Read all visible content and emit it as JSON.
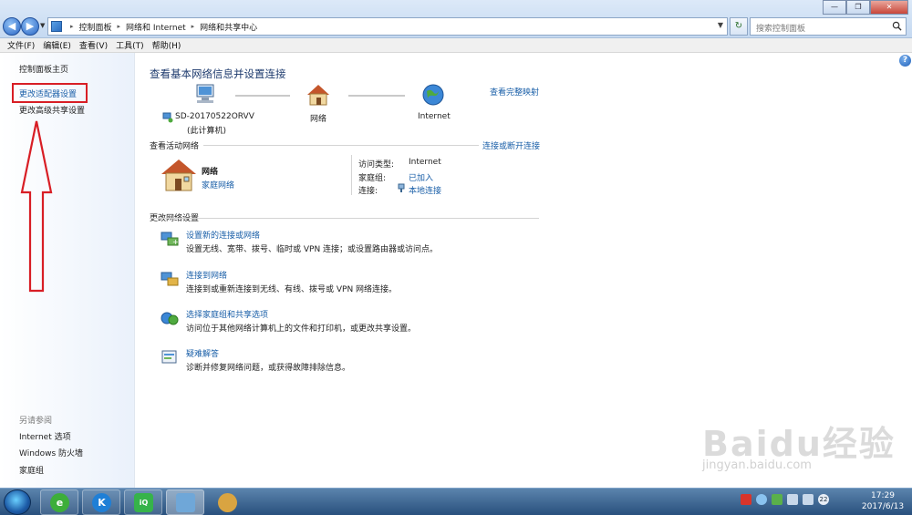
{
  "window": {
    "breadcrumbs": [
      "控制面板",
      "网络和 Internet",
      "网络和共享中心"
    ],
    "search_placeholder": "搜索控制面板"
  },
  "menubar": [
    "文件(F)",
    "编辑(E)",
    "查看(V)",
    "工具(T)",
    "帮助(H)"
  ],
  "sidebar": {
    "items": [
      {
        "label": "控制面板主页"
      },
      {
        "label": "更改适配器设置"
      },
      {
        "label": "更改高级共享设置"
      }
    ],
    "see_also_title": "另请参阅",
    "see_also": [
      "Internet 选项",
      "Windows 防火墙",
      "家庭组"
    ]
  },
  "main": {
    "title": "查看基本网络信息并设置连接",
    "full_map_link": "查看完整映射",
    "map": {
      "computer_name": "SD-20170522ORVV",
      "computer_sub": "(此计算机)",
      "network": "网络",
      "internet": "Internet"
    },
    "active_section": {
      "title": "查看活动网络",
      "link": "连接或断开连接",
      "network_name": "网络",
      "network_type": "家庭网络",
      "access_type_key": "访问类型:",
      "access_type_val": "Internet",
      "homegroup_key": "家庭组:",
      "homegroup_val": "已加入",
      "connection_key": "连接:",
      "connection_val": "本地连接"
    },
    "settings_section": {
      "title": "更改网络设置",
      "tasks": [
        {
          "link": "设置新的连接或网络",
          "desc": "设置无线、宽带、拨号、临时或 VPN 连接；或设置路由器或访问点。"
        },
        {
          "link": "连接到网络",
          "desc": "连接到或重新连接到无线、有线、拨号或 VPN 网络连接。"
        },
        {
          "link": "选择家庭组和共享选项",
          "desc": "访问位于其他网络计算机上的文件和打印机，或更改共享设置。"
        },
        {
          "link": "疑难解答",
          "desc": "诊断并修复网络问题，或获得故障排除信息。"
        }
      ]
    }
  },
  "taskbar": {
    "clock_time": "17:29",
    "clock_date": "2017/6/13",
    "badge": "22"
  },
  "watermark": {
    "text": "Baidu经验",
    "sub": "jingyan.baidu.com"
  },
  "colors": {
    "link": "#1a5fa8",
    "highlight": "#d81e25",
    "taskbar": "#29507d"
  }
}
